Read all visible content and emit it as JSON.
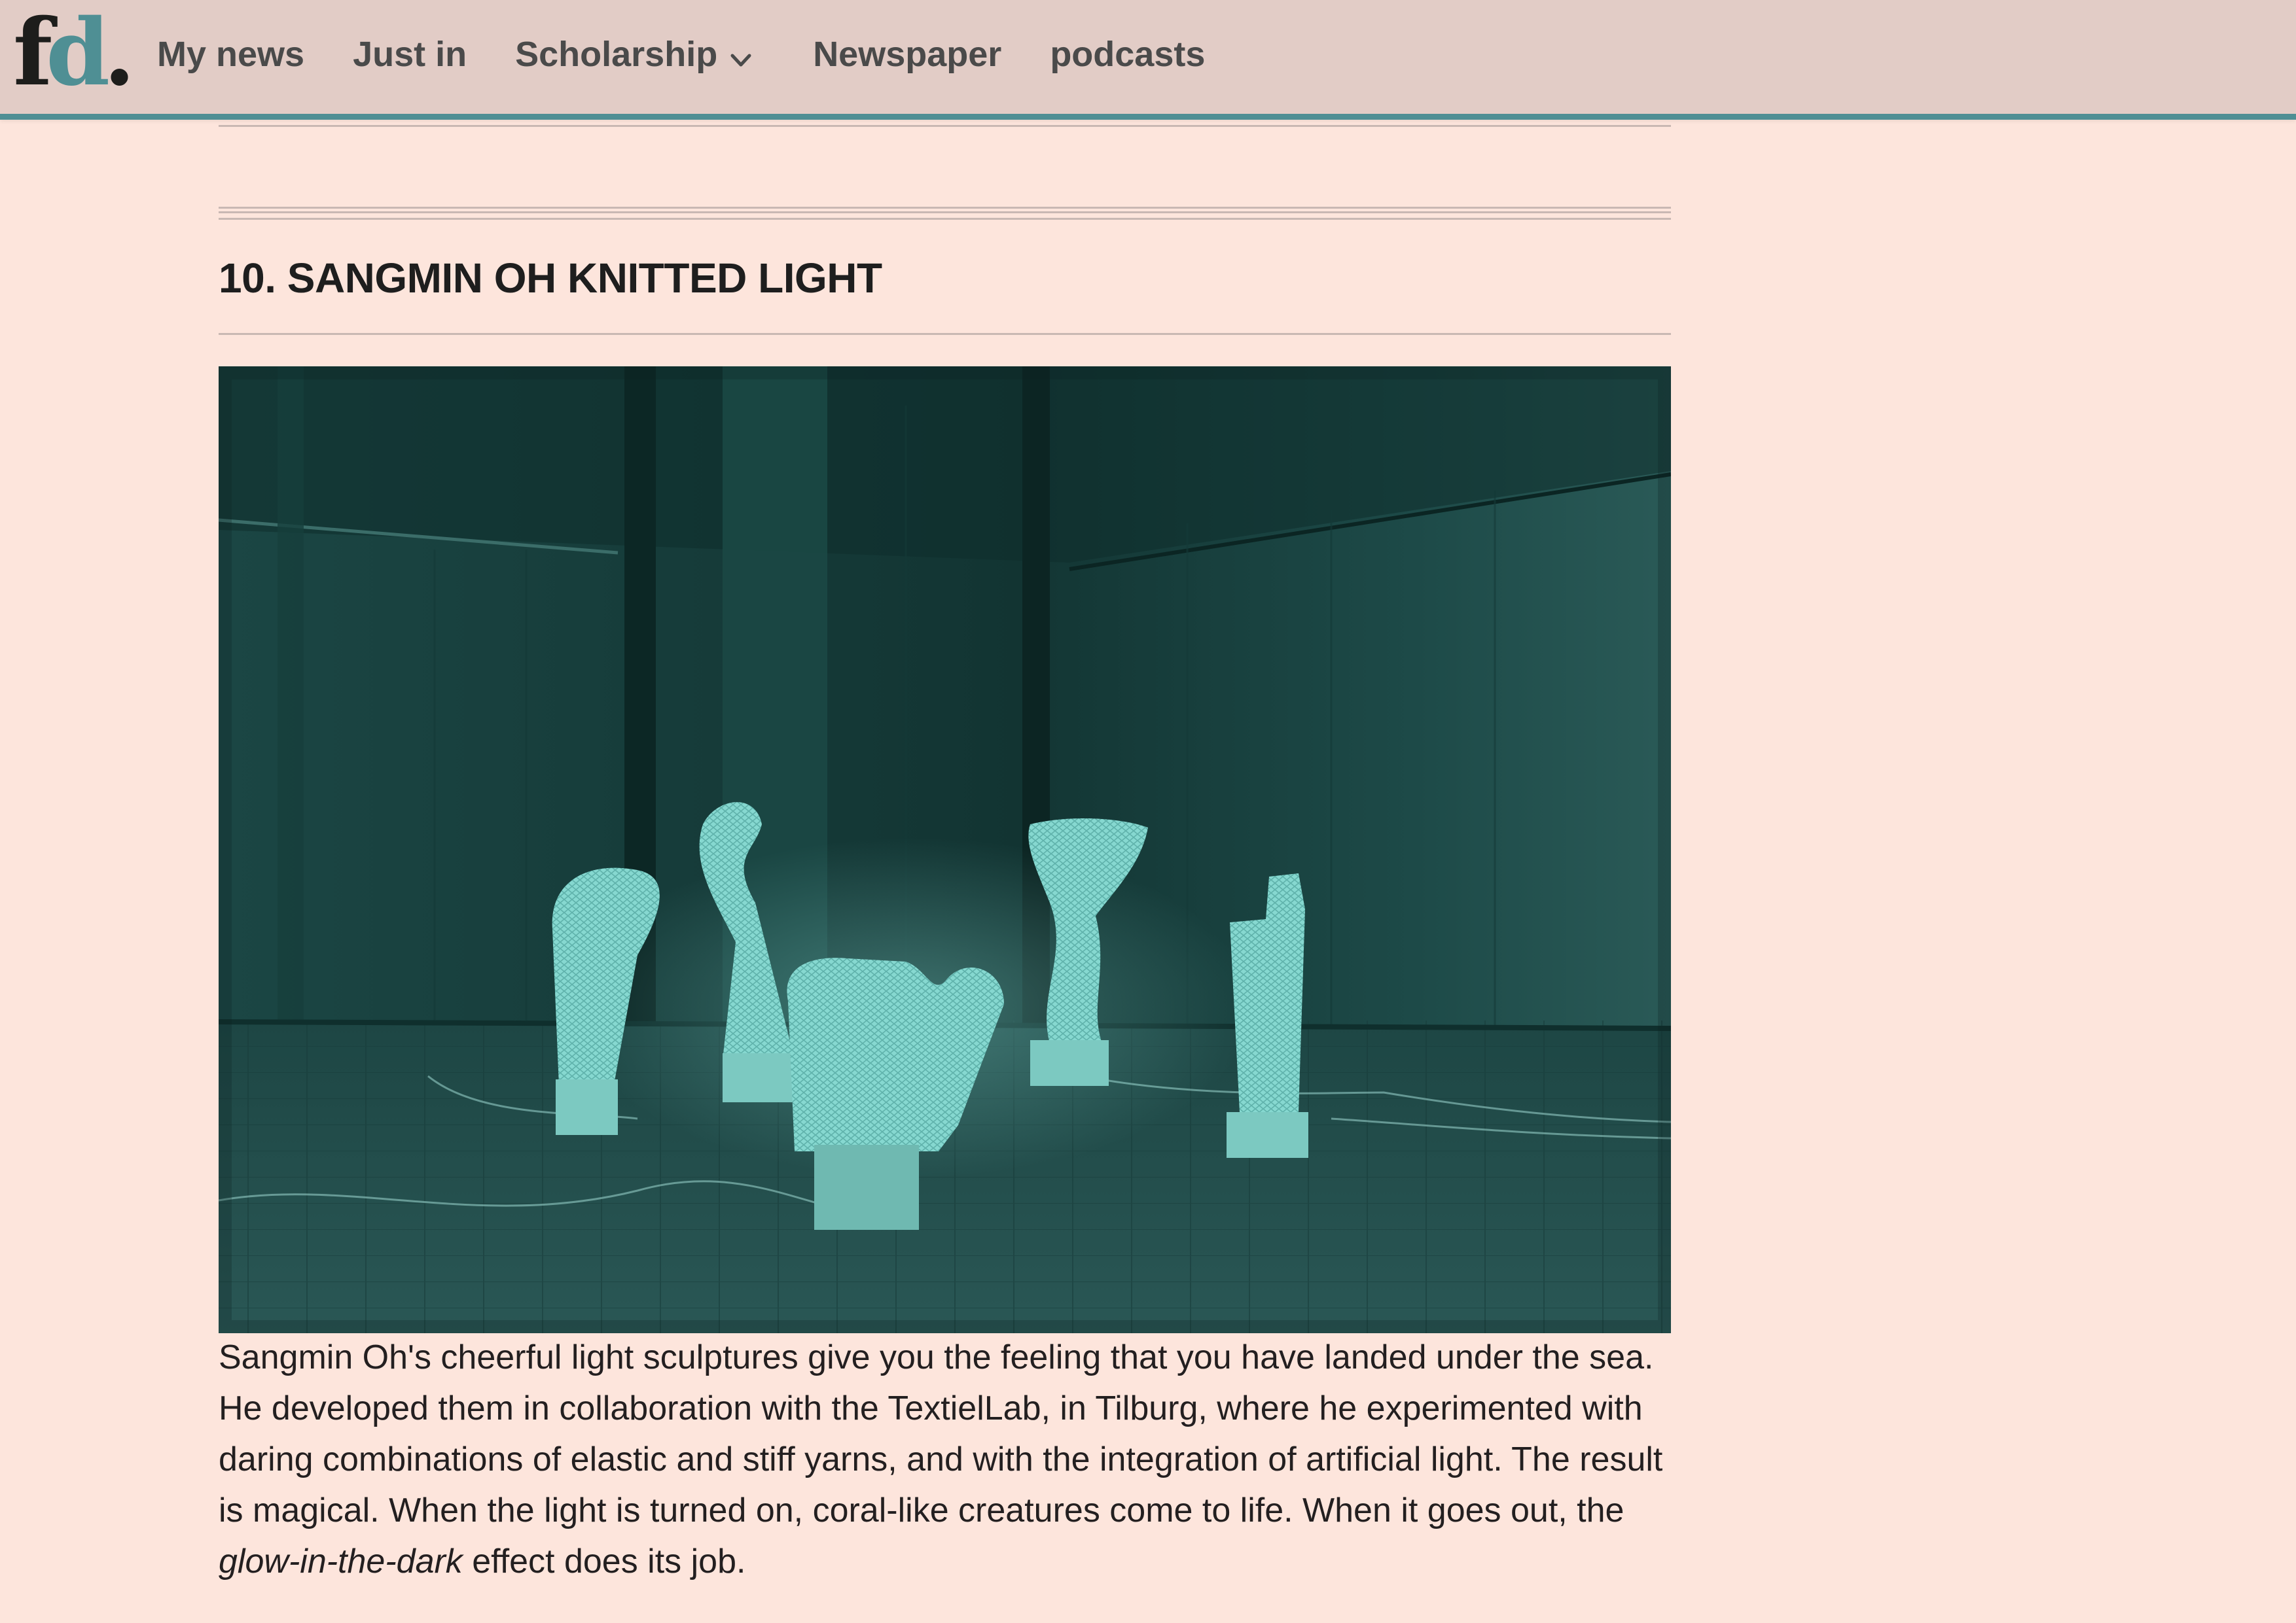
{
  "header": {
    "logo": {
      "f": "f",
      "d": "d",
      "dot": "."
    },
    "nav": [
      {
        "label": "My news"
      },
      {
        "label": "Just in"
      },
      {
        "label": "Scholarship",
        "has_dropdown": true,
        "icon": "chevron-down-icon"
      },
      {
        "label": "Newspaper"
      },
      {
        "label": "podcasts"
      }
    ]
  },
  "article": {
    "title": "10. SANGMIN OH KNITTED LIGHT",
    "body": {
      "before_em": "Sangmin Oh's cheerful light sculptures give you the feeling that you have landed under the sea. He developed them in collaboration with the TextielLab, in Tilburg, where he experimented with daring combinations of elastic and stiff yarns, and with the integration of artificial light. The result is magical. When the light is turned on, coral-like creatures come to life. When it goes out, the ",
      "em": "glow-in-the-dark",
      "after_em": " effect does its job."
    }
  },
  "colors": {
    "page_background": "#fde5dc",
    "header_background": "#e2ccc6",
    "header_accent": "#4f8f94",
    "photo_teal": "#7fd3cc"
  }
}
